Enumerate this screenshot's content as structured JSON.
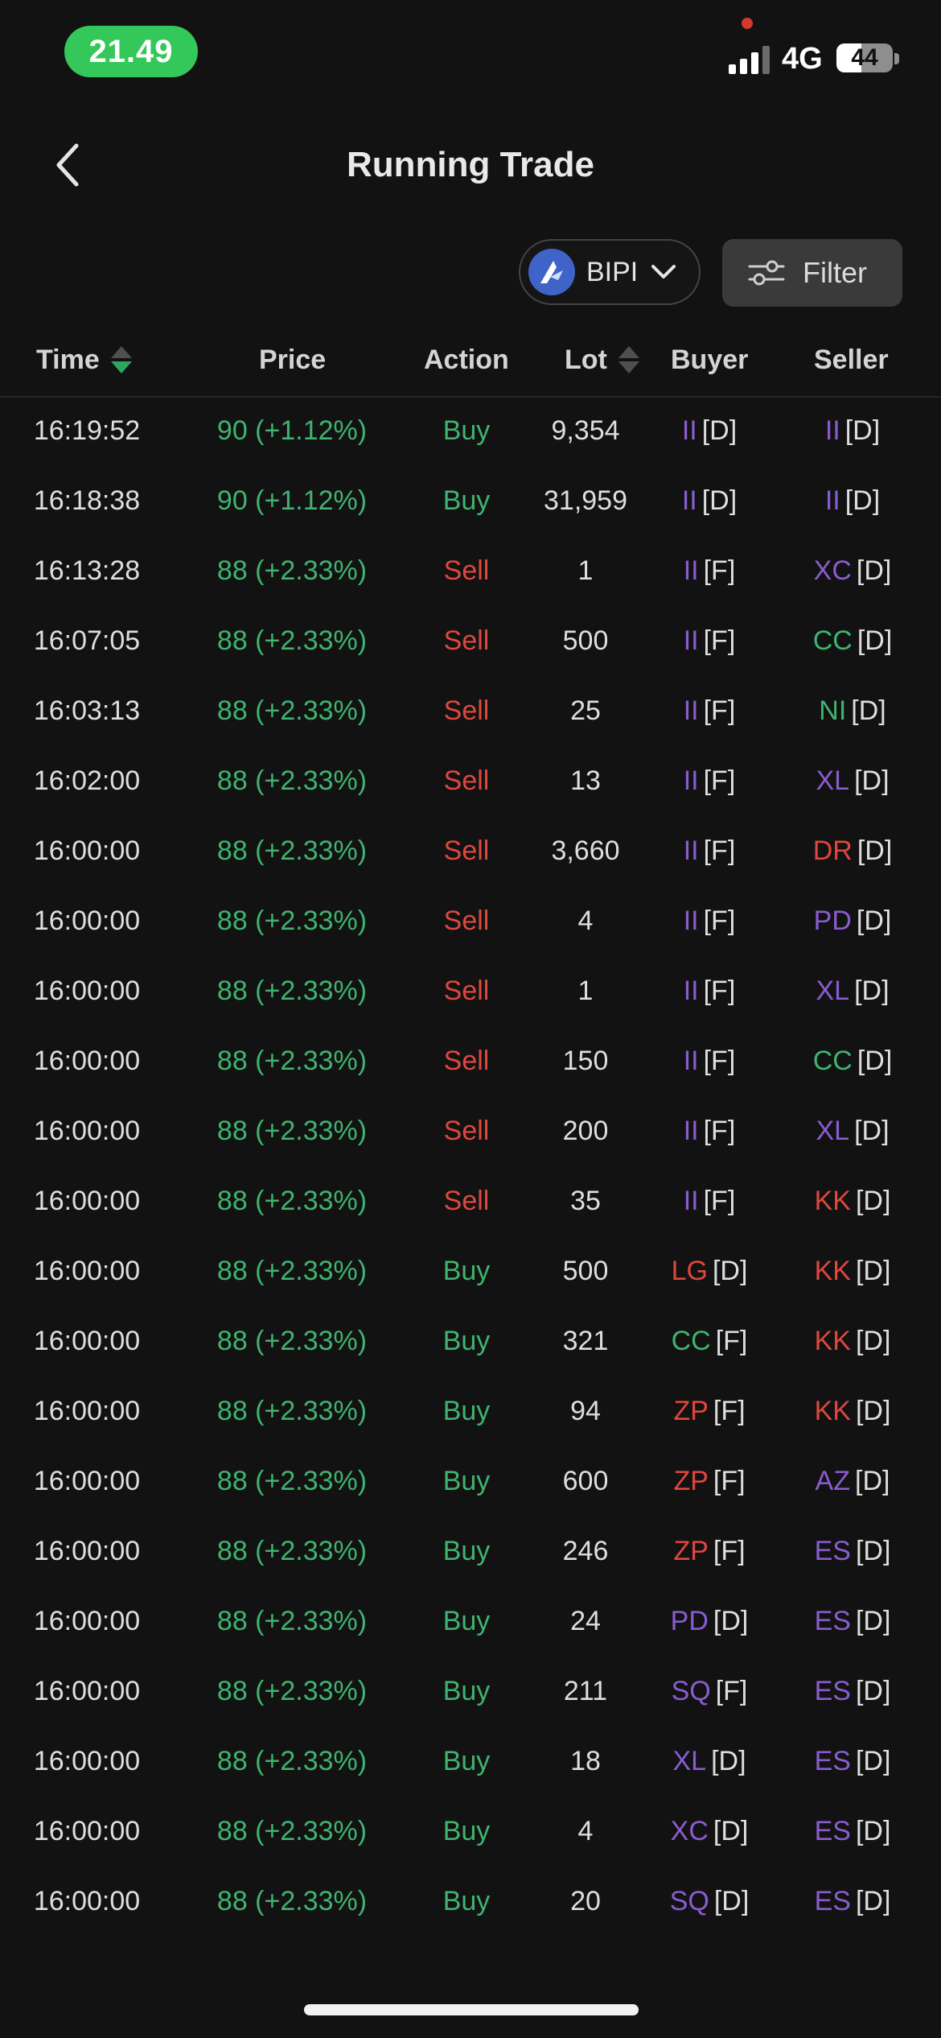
{
  "status_bar": {
    "time": "21.49",
    "network": "4G",
    "battery": "44",
    "battery_level": 0.44
  },
  "header": {
    "title": "Running Trade"
  },
  "controls": {
    "stock_code": "BIPI",
    "filter_label": "Filter"
  },
  "table": {
    "headers": {
      "time": "Time",
      "price": "Price",
      "action": "Action",
      "lot": "Lot",
      "buyer": "Buyer",
      "seller": "Seller"
    },
    "rows": [
      {
        "time": "16:19:52",
        "price": "90 (+1.12%)",
        "action": "Buy",
        "lot": "9,354",
        "buyer_code": "II",
        "buyer_type": "[D]",
        "buyer_color": "#8a5cd0",
        "seller_code": "II",
        "seller_type": "[D]",
        "seller_color": "#8a5cd0"
      },
      {
        "time": "16:18:38",
        "price": "90 (+1.12%)",
        "action": "Buy",
        "lot": "31,959",
        "buyer_code": "II",
        "buyer_type": "[D]",
        "buyer_color": "#8a5cd0",
        "seller_code": "II",
        "seller_type": "[D]",
        "seller_color": "#8a5cd0"
      },
      {
        "time": "16:13:28",
        "price": "88 (+2.33%)",
        "action": "Sell",
        "lot": "1",
        "buyer_code": "II",
        "buyer_type": "[F]",
        "buyer_color": "#8a5cd0",
        "seller_code": "XC",
        "seller_type": "[D]",
        "seller_color": "#8a5cd0"
      },
      {
        "time": "16:07:05",
        "price": "88 (+2.33%)",
        "action": "Sell",
        "lot": "500",
        "buyer_code": "II",
        "buyer_type": "[F]",
        "buyer_color": "#8a5cd0",
        "seller_code": "CC",
        "seller_type": "[D]",
        "seller_color": "#3fb36f"
      },
      {
        "time": "16:03:13",
        "price": "88 (+2.33%)",
        "action": "Sell",
        "lot": "25",
        "buyer_code": "II",
        "buyer_type": "[F]",
        "buyer_color": "#8a5cd0",
        "seller_code": "NI",
        "seller_type": "[D]",
        "seller_color": "#3fb36f"
      },
      {
        "time": "16:02:00",
        "price": "88 (+2.33%)",
        "action": "Sell",
        "lot": "13",
        "buyer_code": "II",
        "buyer_type": "[F]",
        "buyer_color": "#8a5cd0",
        "seller_code": "XL",
        "seller_type": "[D]",
        "seller_color": "#8a5cd0"
      },
      {
        "time": "16:00:00",
        "price": "88 (+2.33%)",
        "action": "Sell",
        "lot": "3,660",
        "buyer_code": "II",
        "buyer_type": "[F]",
        "buyer_color": "#8a5cd0",
        "seller_code": "DR",
        "seller_type": "[D]",
        "seller_color": "#e0473d"
      },
      {
        "time": "16:00:00",
        "price": "88 (+2.33%)",
        "action": "Sell",
        "lot": "4",
        "buyer_code": "II",
        "buyer_type": "[F]",
        "buyer_color": "#8a5cd0",
        "seller_code": "PD",
        "seller_type": "[D]",
        "seller_color": "#8a5cd0"
      },
      {
        "time": "16:00:00",
        "price": "88 (+2.33%)",
        "action": "Sell",
        "lot": "1",
        "buyer_code": "II",
        "buyer_type": "[F]",
        "buyer_color": "#8a5cd0",
        "seller_code": "XL",
        "seller_type": "[D]",
        "seller_color": "#8a5cd0"
      },
      {
        "time": "16:00:00",
        "price": "88 (+2.33%)",
        "action": "Sell",
        "lot": "150",
        "buyer_code": "II",
        "buyer_type": "[F]",
        "buyer_color": "#8a5cd0",
        "seller_code": "CC",
        "seller_type": "[D]",
        "seller_color": "#3fb36f"
      },
      {
        "time": "16:00:00",
        "price": "88 (+2.33%)",
        "action": "Sell",
        "lot": "200",
        "buyer_code": "II",
        "buyer_type": "[F]",
        "buyer_color": "#8a5cd0",
        "seller_code": "XL",
        "seller_type": "[D]",
        "seller_color": "#8a5cd0"
      },
      {
        "time": "16:00:00",
        "price": "88 (+2.33%)",
        "action": "Sell",
        "lot": "35",
        "buyer_code": "II",
        "buyer_type": "[F]",
        "buyer_color": "#8a5cd0",
        "seller_code": "KK",
        "seller_type": "[D]",
        "seller_color": "#e0473d"
      },
      {
        "time": "16:00:00",
        "price": "88 (+2.33%)",
        "action": "Buy",
        "lot": "500",
        "buyer_code": "LG",
        "buyer_type": "[D]",
        "buyer_color": "#e0473d",
        "seller_code": "KK",
        "seller_type": "[D]",
        "seller_color": "#e0473d"
      },
      {
        "time": "16:00:00",
        "price": "88 (+2.33%)",
        "action": "Buy",
        "lot": "321",
        "buyer_code": "CC",
        "buyer_type": "[F]",
        "buyer_color": "#3fb36f",
        "seller_code": "KK",
        "seller_type": "[D]",
        "seller_color": "#e0473d"
      },
      {
        "time": "16:00:00",
        "price": "88 (+2.33%)",
        "action": "Buy",
        "lot": "94",
        "buyer_code": "ZP",
        "buyer_type": "[F]",
        "buyer_color": "#e0473d",
        "seller_code": "KK",
        "seller_type": "[D]",
        "seller_color": "#e0473d"
      },
      {
        "time": "16:00:00",
        "price": "88 (+2.33%)",
        "action": "Buy",
        "lot": "600",
        "buyer_code": "ZP",
        "buyer_type": "[F]",
        "buyer_color": "#e0473d",
        "seller_code": "AZ",
        "seller_type": "[D]",
        "seller_color": "#8a5cd0"
      },
      {
        "time": "16:00:00",
        "price": "88 (+2.33%)",
        "action": "Buy",
        "lot": "246",
        "buyer_code": "ZP",
        "buyer_type": "[F]",
        "buyer_color": "#e0473d",
        "seller_code": "ES",
        "seller_type": "[D]",
        "seller_color": "#8a5cd0"
      },
      {
        "time": "16:00:00",
        "price": "88 (+2.33%)",
        "action": "Buy",
        "lot": "24",
        "buyer_code": "PD",
        "buyer_type": "[D]",
        "buyer_color": "#8a5cd0",
        "seller_code": "ES",
        "seller_type": "[D]",
        "seller_color": "#8a5cd0"
      },
      {
        "time": "16:00:00",
        "price": "88 (+2.33%)",
        "action": "Buy",
        "lot": "211",
        "buyer_code": "SQ",
        "buyer_type": "[F]",
        "buyer_color": "#8a5cd0",
        "seller_code": "ES",
        "seller_type": "[D]",
        "seller_color": "#8a5cd0"
      },
      {
        "time": "16:00:00",
        "price": "88 (+2.33%)",
        "action": "Buy",
        "lot": "18",
        "buyer_code": "XL",
        "buyer_type": "[D]",
        "buyer_color": "#8a5cd0",
        "seller_code": "ES",
        "seller_type": "[D]",
        "seller_color": "#8a5cd0"
      },
      {
        "time": "16:00:00",
        "price": "88 (+2.33%)",
        "action": "Buy",
        "lot": "4",
        "buyer_code": "XC",
        "buyer_type": "[D]",
        "buyer_color": "#8a5cd0",
        "seller_code": "ES",
        "seller_type": "[D]",
        "seller_color": "#8a5cd0"
      },
      {
        "time": "16:00:00",
        "price": "88 (+2.33%)",
        "action": "Buy",
        "lot": "20",
        "buyer_code": "SQ",
        "buyer_type": "[D]",
        "buyer_color": "#8a5cd0",
        "seller_code": "ES",
        "seller_type": "[D]",
        "seller_color": "#8a5cd0"
      }
    ]
  },
  "colors": {
    "background": "#121212",
    "buy": "#3fb36f",
    "sell": "#e0473d",
    "broker_purple": "#8a5cd0",
    "sort_active": "#2fa562",
    "status_pill": "#34c759"
  },
  "icons": {
    "back": "chevron-left-icon",
    "stock_logo": "stock-logo-icon",
    "dropdown": "chevron-down-icon",
    "filter": "sliders-icon",
    "sort": "sort-arrows-icon"
  }
}
